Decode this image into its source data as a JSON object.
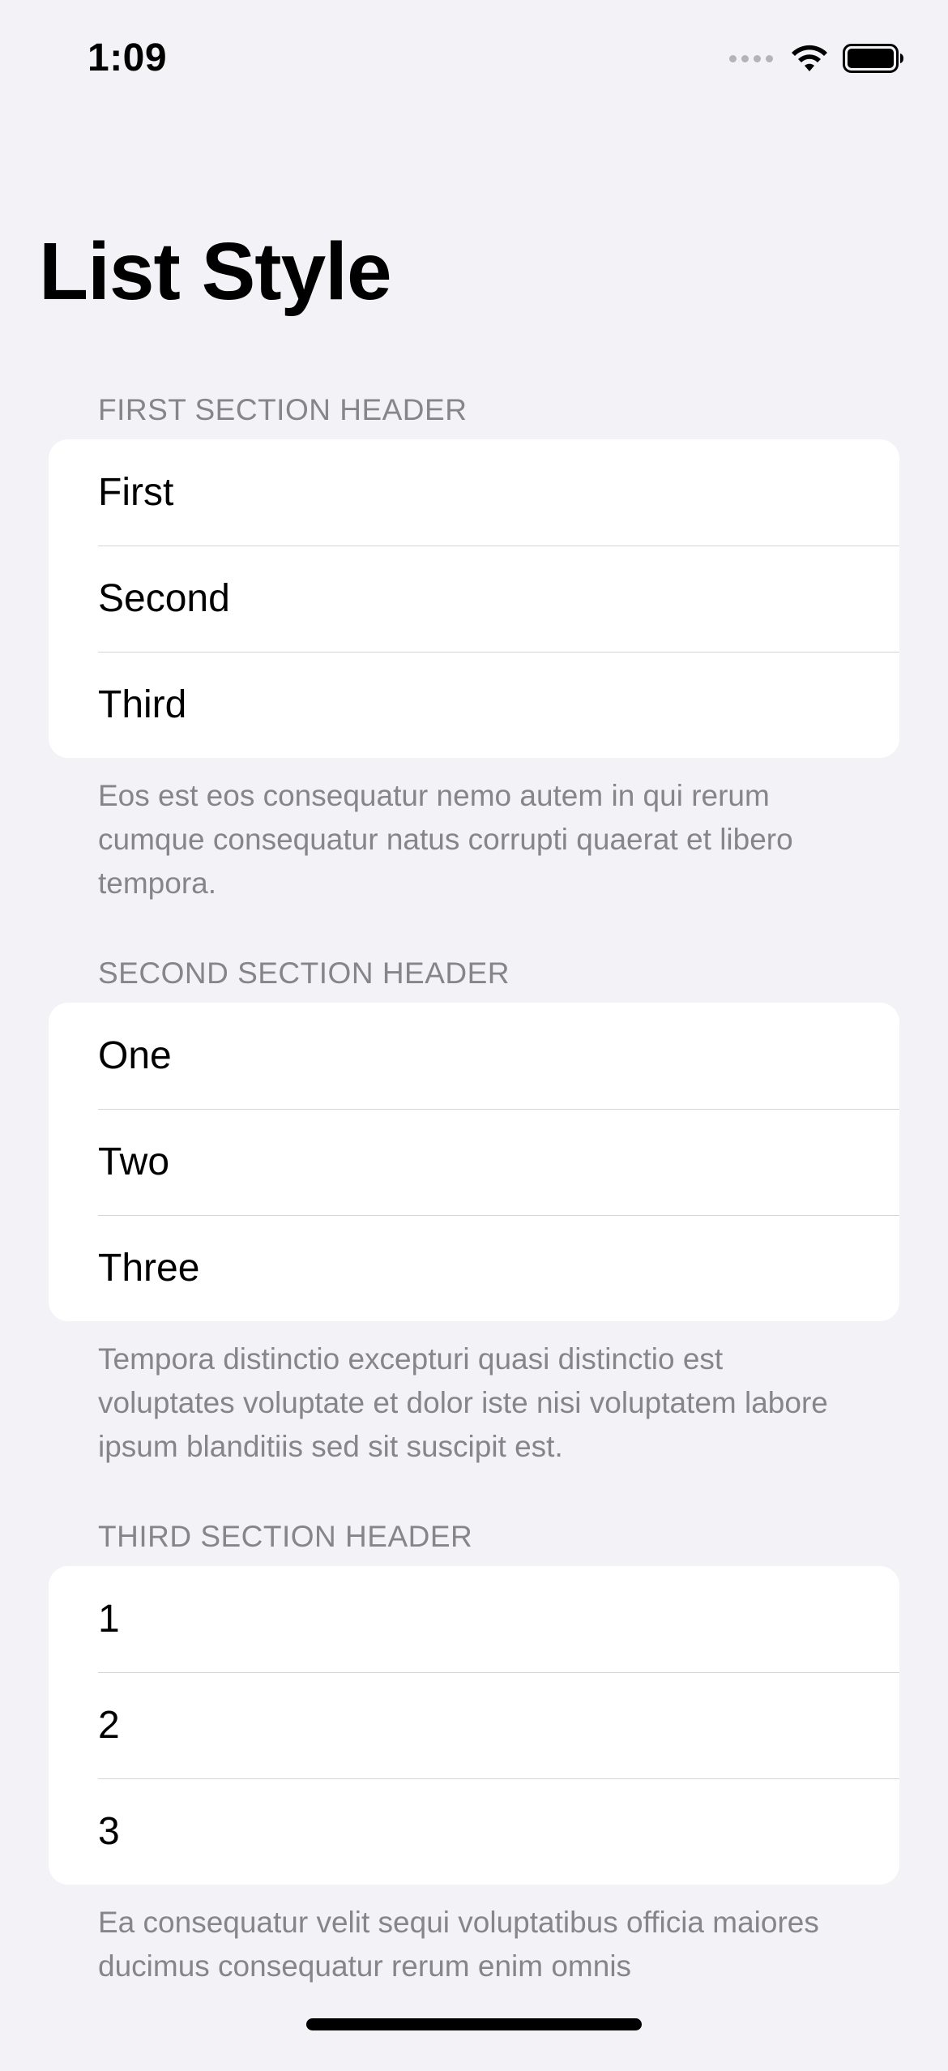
{
  "status_bar": {
    "time": "1:09"
  },
  "title": "List Style",
  "sections": [
    {
      "header": "FIRST SECTION HEADER",
      "rows": [
        "First",
        "Second",
        "Third"
      ],
      "footer": "Eos est eos consequatur nemo autem in qui rerum cumque consequatur natus corrupti quaerat et libero tempora."
    },
    {
      "header": "SECOND SECTION HEADER",
      "rows": [
        "One",
        "Two",
        "Three"
      ],
      "footer": "Tempora distinctio excepturi quasi distinctio est voluptates voluptate et dolor iste nisi voluptatem labore ipsum blanditiis sed sit suscipit est."
    },
    {
      "header": "THIRD SECTION HEADER",
      "rows": [
        "1",
        "2",
        "3"
      ],
      "footer": "Ea consequatur velit sequi voluptatibus officia maiores ducimus consequatur rerum enim omnis"
    }
  ]
}
